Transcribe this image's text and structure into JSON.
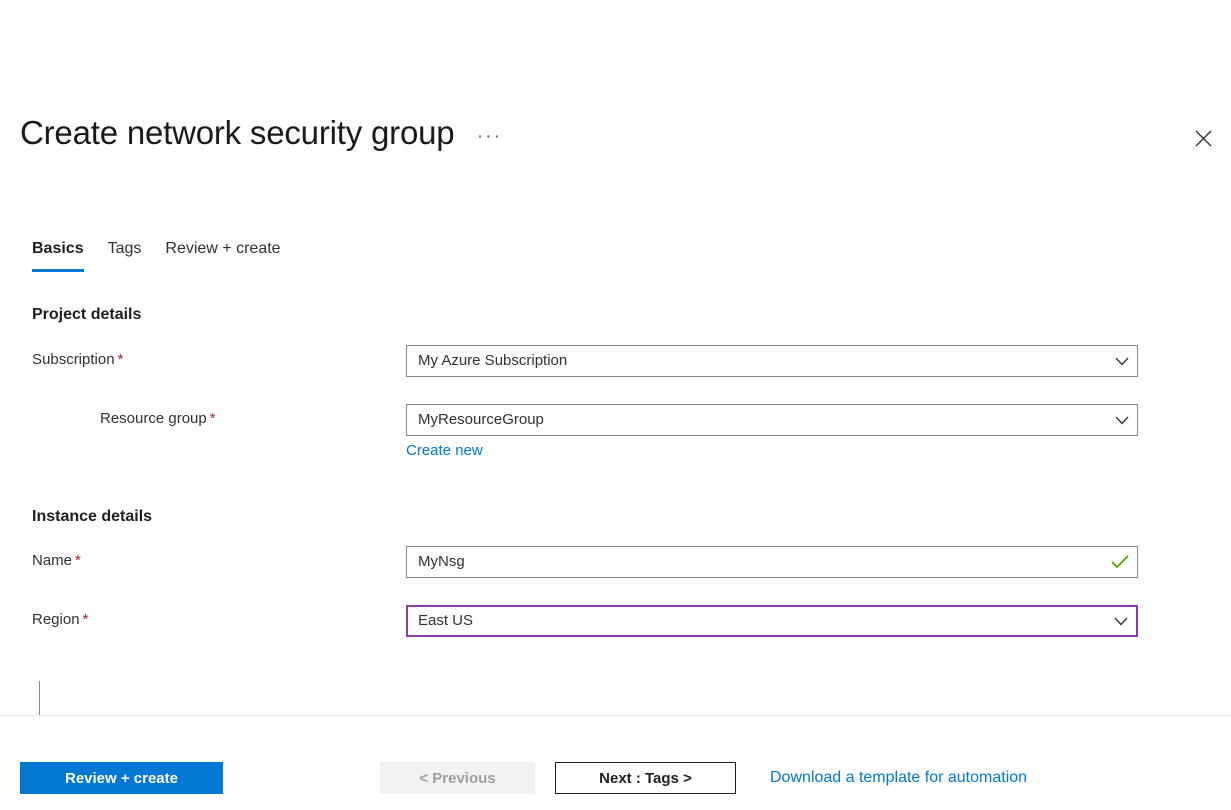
{
  "blade": {
    "title": "Create network security group",
    "more_actions_label": "···",
    "close_icon": "close-icon",
    "accent_color": "#0078d4"
  },
  "tabs": [
    {
      "label": "Basics",
      "active": true
    },
    {
      "label": "Tags",
      "active": false
    },
    {
      "label": "Review + create",
      "active": false
    }
  ],
  "sections": [
    {
      "title": "Project details",
      "fields": [
        {
          "label": "Subscription",
          "required": true,
          "required_marker": "*",
          "value": "My Azure Subscription",
          "control": "dropdown",
          "icon": "chevron-down-icon",
          "focused": false
        },
        {
          "label": "Resource group",
          "required": true,
          "required_marker": "*",
          "value": "MyResourceGroup",
          "control": "dropdown",
          "icon": "chevron-down-icon",
          "focused": false,
          "sub_link": "Create new",
          "indented": true
        }
      ]
    },
    {
      "title": "Instance details",
      "fields": [
        {
          "label": "Name",
          "required": true,
          "required_marker": "*",
          "value": "MyNsg",
          "control": "text",
          "icon": "checkmark-valid-icon",
          "focused": false
        },
        {
          "label": "Region",
          "required": true,
          "required_marker": "*",
          "value": "East US",
          "control": "dropdown",
          "icon": "chevron-down-icon",
          "focused": true
        }
      ]
    }
  ],
  "footer": {
    "review_create_label": "Review + create",
    "previous_label": "< Previous",
    "previous_disabled": true,
    "next_label": "Next : Tags >",
    "download_template_label": "Download a template for automation"
  },
  "colors": {
    "azure_blue": "#0078d4",
    "required_red": "#a4262c",
    "focus_purple": "#8c3ea8",
    "valid_green": "#57a300",
    "border_gray": "#8a8886"
  }
}
